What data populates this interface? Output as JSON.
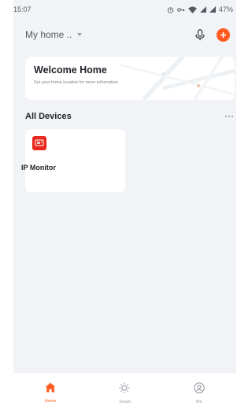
{
  "status_bar": {
    "time": "15:07",
    "battery": "47%",
    "icons": [
      "alarm-icon",
      "key-icon",
      "wifi-icon",
      "signal-icon",
      "signal-icon"
    ]
  },
  "header": {
    "home_name": "My home ..",
    "icons": [
      "microphone-icon",
      "add-icon"
    ]
  },
  "welcome_card": {
    "title": "Welcome Home",
    "subtitle": "Set your home location for more information"
  },
  "devices_section": {
    "title": "All Devices",
    "devices": [
      {
        "name": "IP Monitor",
        "icon": "ip-monitor-icon"
      }
    ]
  },
  "tab_bar": {
    "tabs": [
      {
        "label": "Home",
        "icon": "home-icon",
        "active": true
      },
      {
        "label": "Smart",
        "icon": "sun-icon",
        "active": false
      },
      {
        "label": "Me",
        "icon": "user-icon",
        "active": false
      }
    ]
  },
  "colors": {
    "accent": "#ff5a1f",
    "device_icon_bg": "#e8281c",
    "background": "#f2f3f6"
  }
}
